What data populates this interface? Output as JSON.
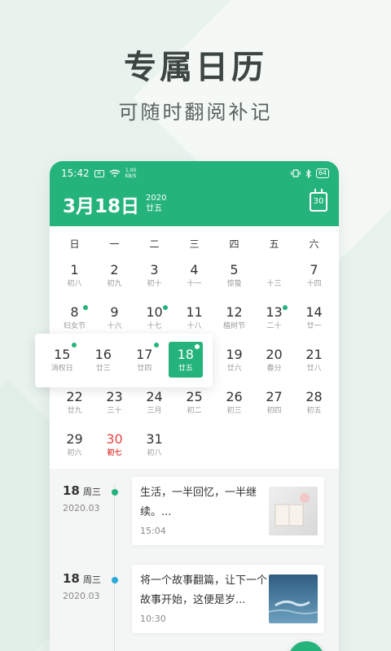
{
  "hero": {
    "title": "专属日历",
    "subtitle": "可随时翻阅补记"
  },
  "status_bar": {
    "time": "15:42",
    "x_badge": "✕",
    "net_speed_value": "1.00",
    "net_speed_unit": "KB/S",
    "battery": "64"
  },
  "header": {
    "month_day": "3月18日",
    "year": "2020",
    "lunar": "廿五",
    "calendar_icon_day": "30"
  },
  "weekdays": [
    "日",
    "一",
    "二",
    "三",
    "四",
    "五",
    "六"
  ],
  "calendar": {
    "row1": [
      {
        "num": "1",
        "lunar": "初八"
      },
      {
        "num": "2",
        "lunar": "初九"
      },
      {
        "num": "3",
        "lunar": "初十"
      },
      {
        "num": "4",
        "lunar": "十一"
      },
      {
        "num": "5",
        "lunar": "惊蛰"
      },
      {
        "num": "",
        "lunar": "十三"
      },
      {
        "num": "7",
        "lunar": "十四"
      }
    ],
    "row2": [
      {
        "num": "8",
        "lunar": "妇女节"
      },
      {
        "num": "9",
        "lunar": "十六"
      },
      {
        "num": "10",
        "lunar": "十七"
      },
      {
        "num": "11",
        "lunar": "十八"
      },
      {
        "num": "12",
        "lunar": "植树节"
      },
      {
        "num": "13",
        "lunar": "二十"
      },
      {
        "num": "14",
        "lunar": "廿一"
      }
    ],
    "row3": [
      {
        "num": "19",
        "lunar": "廿六"
      },
      {
        "num": "20",
        "lunar": "春分"
      },
      {
        "num": "21",
        "lunar": "廿八"
      }
    ],
    "row4": [
      {
        "num": "22",
        "lunar": "廿九"
      },
      {
        "num": "23",
        "lunar": "三十"
      },
      {
        "num": "24",
        "lunar": "三月"
      },
      {
        "num": "25",
        "lunar": "初二"
      },
      {
        "num": "26",
        "lunar": "初三"
      },
      {
        "num": "27",
        "lunar": "初四"
      },
      {
        "num": "28",
        "lunar": "初五"
      }
    ],
    "row5": [
      {
        "num": "29",
        "lunar": "初六"
      },
      {
        "num": "30",
        "lunar": "初七"
      },
      {
        "num": "31",
        "lunar": "初八"
      }
    ]
  },
  "popup": [
    {
      "num": "15",
      "lunar": "消权日"
    },
    {
      "num": "16",
      "lunar": "廿三"
    },
    {
      "num": "17",
      "lunar": "廿四"
    },
    {
      "num": "18",
      "lunar": "廿五"
    }
  ],
  "entries": [
    {
      "day": "18",
      "weekday": "周三",
      "year_month": "2020.03",
      "text": "生活，一半回忆，一半继续。...",
      "time": "15:04",
      "node_color": "#25b37c"
    },
    {
      "day": "18",
      "weekday": "周三",
      "year_month": "2020.03",
      "text": "将一个故事翻篇，让下一个故事开始，这便是岁...",
      "time": "10:30",
      "node_color": "#29a9d8"
    }
  ],
  "icons": {
    "fab": "pencil-icon",
    "calendar": "calendar-icon"
  },
  "colors": {
    "brand": "#25b37c",
    "holiday_red": "#e64545"
  }
}
